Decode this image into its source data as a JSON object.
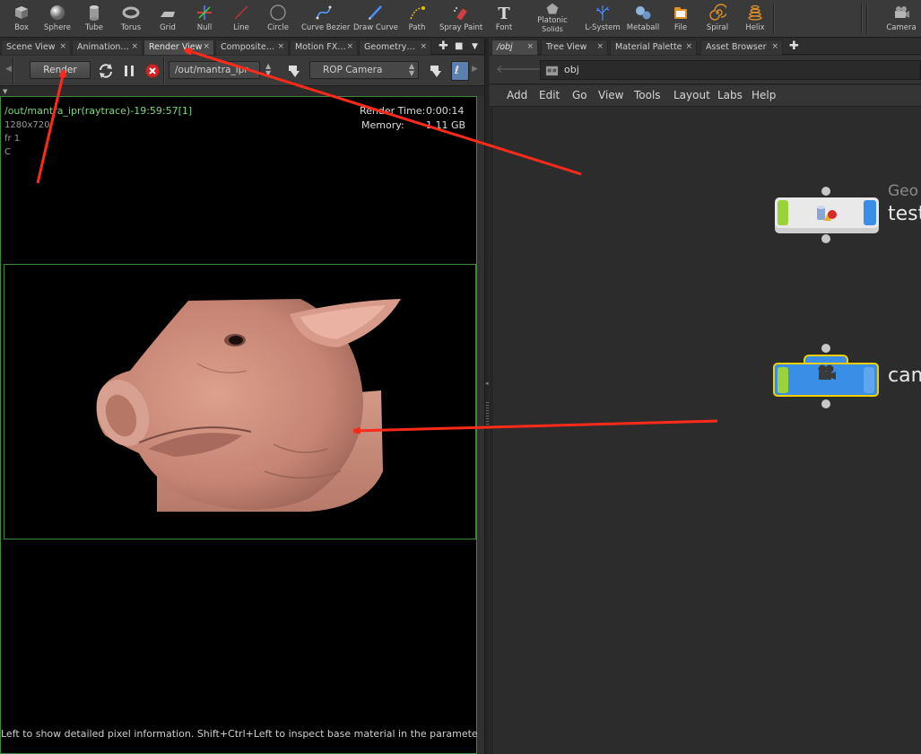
{
  "shelf": {
    "tools": [
      {
        "label": "Box",
        "icon": "box-icon"
      },
      {
        "label": "Sphere",
        "icon": "sphere-icon"
      },
      {
        "label": "Tube",
        "icon": "tube-icon"
      },
      {
        "label": "Torus",
        "icon": "torus-icon"
      },
      {
        "label": "Grid",
        "icon": "grid-icon"
      },
      {
        "label": "Null",
        "icon": "null-icon"
      },
      {
        "label": "Line",
        "icon": "line-icon"
      },
      {
        "label": "Circle",
        "icon": "circle-icon"
      },
      {
        "label": "Curve Bezier",
        "icon": "curve-bezier-icon"
      },
      {
        "label": "Draw Curve",
        "icon": "draw-curve-icon"
      },
      {
        "label": "Path",
        "icon": "path-icon"
      },
      {
        "label": "Spray Paint",
        "icon": "spray-paint-icon"
      },
      {
        "label": "Font",
        "icon": "font-icon"
      },
      {
        "label": "Platonic",
        "label2": "Solids",
        "icon": "platonic-solids-icon"
      },
      {
        "label": "L-System",
        "icon": "l-system-icon"
      },
      {
        "label": "Metaball",
        "icon": "metaball-icon"
      },
      {
        "label": "File",
        "icon": "file-icon"
      },
      {
        "label": "Spiral",
        "icon": "spiral-icon"
      },
      {
        "label": "Helix",
        "icon": "helix-icon"
      }
    ],
    "camera_label": "Camera"
  },
  "left_tabs": [
    "Scene View",
    "Animation…",
    "Render View",
    "Composite…",
    "Motion FX…",
    "Geometry…"
  ],
  "right_tabs": [
    "/obj",
    "Tree View",
    "Material Palette",
    "Asset Browser"
  ],
  "render_toolbar": {
    "render_button": "Render",
    "output_path": "/out/mantra_ipr",
    "camera": "ROP Camera"
  },
  "overlay": {
    "title": "/out/mantra_ipr(raytrace)-19:59:57[1]",
    "resolution": "1280x720",
    "frame": "fr 1",
    "channel": "C",
    "render_time_label": "Render Time:",
    "render_time": "0:00:14",
    "memory_label": "Memory:",
    "memory": "1.11 GB"
  },
  "status_text": "Left to show detailed pixel information. Shift+Ctrl+Left to inspect base material in the parameter d",
  "network": {
    "path": "obj",
    "menus": [
      "Add",
      "Edit",
      "Go",
      "View",
      "Tools",
      "Layout",
      "Labs",
      "Help"
    ],
    "nodes": [
      {
        "type": "Geo",
        "name": "test"
      },
      {
        "type": "",
        "name": "cam"
      }
    ]
  },
  "colors": {
    "accent_green": "#3d8a3d",
    "overlay_title": "#7cd87c",
    "annotation_red": "#ff2a1a",
    "node_select": "#f0d000"
  }
}
